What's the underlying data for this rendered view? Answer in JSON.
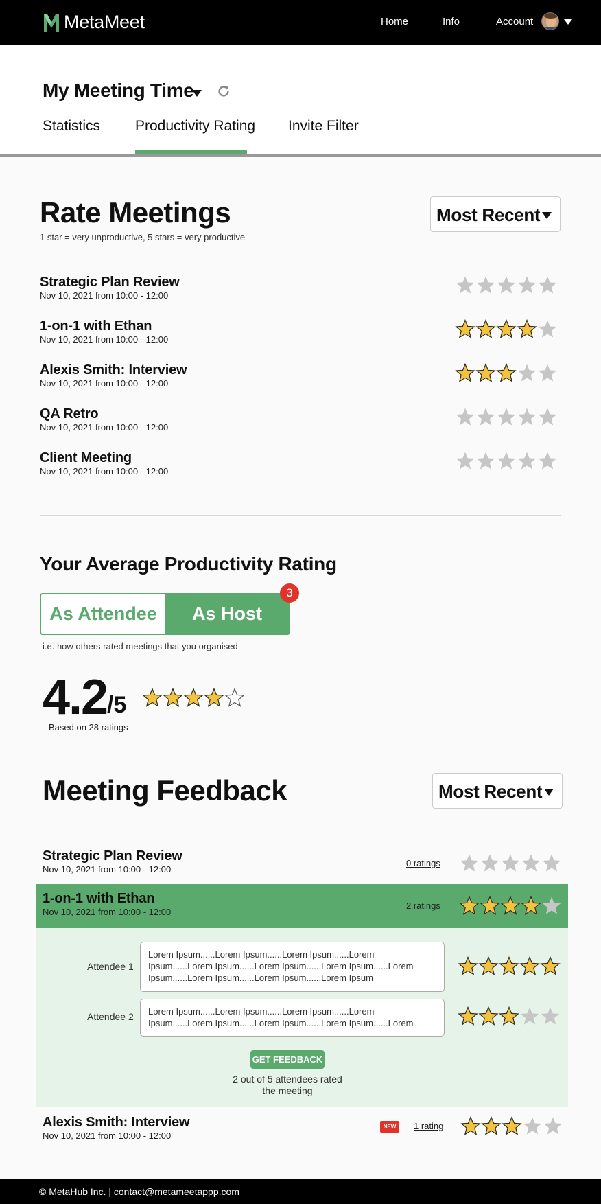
{
  "header": {
    "app_name": "MetaMeet",
    "nav": [
      "Home",
      "Info",
      "Account"
    ]
  },
  "subheader": {
    "title": "My Meeting Time",
    "tabs": [
      "Statistics",
      "Productivity Rating",
      "Invite Filter"
    ],
    "active_tab": "Productivity Rating"
  },
  "rate": {
    "title": "Rate Meetings",
    "hint": "1 star = very unproductive, 5 stars = very productive",
    "sort_label": "Most Recent",
    "meetings": [
      {
        "title": "Strategic Plan Review",
        "subtitle": "Nov 10, 2021 from 10:00 - 12:00",
        "stars": 0
      },
      {
        "title": "1-on-1 with Ethan",
        "subtitle": "Nov 10, 2021 from 10:00 - 12:00",
        "stars": 4
      },
      {
        "title": "Alexis Smith: Interview",
        "subtitle": "Nov 10, 2021 from 10:00 - 12:00",
        "stars": 3
      },
      {
        "title": "QA Retro",
        "subtitle": "Nov 10, 2021 from 10:00 - 12:00",
        "stars": 0
      },
      {
        "title": "Client Meeting",
        "subtitle": "Nov 10, 2021 from 10:00 - 12:00",
        "stars": 0
      }
    ]
  },
  "average": {
    "title": "Your Average Productivity Rating",
    "toggle_attendee": "As Attendee",
    "toggle_host": "As Host",
    "host_badge": "3",
    "hint": "i.e. how others rated meetings that you organised",
    "value": "4.2",
    "denominator": "/5",
    "stars": 4,
    "based_on": "Based on 28 ratings"
  },
  "feedback": {
    "title": "Meeting Feedback",
    "sort_label": "Most Recent",
    "items": [
      {
        "title": "Strategic Plan Review",
        "subtitle": "Nov 10, 2021 from 10:00 - 12:00",
        "ratings_label": "0 ratings",
        "stars": 0
      },
      {
        "title": "1-on-1 with Ethan",
        "subtitle": "Nov 10, 2021 from 10:00 - 12:00",
        "ratings_label": "2 ratings",
        "stars": 4
      },
      {
        "title": "Alexis Smith: Interview",
        "subtitle": "Nov 10, 2021 from 10:00 - 12:00",
        "ratings_label": "1 rating",
        "stars": 3,
        "badge": "NEW"
      }
    ],
    "expanded": {
      "attendees": [
        {
          "label": "Attendee 1",
          "comment": "Lorem Ipsum......Lorem Ipsum......Lorem Ipsum......Lorem Ipsum......Lorem Ipsum......Lorem Ipsum......Lorem Ipsum......Lorem Ipsum......Lorem Ipsum......Lorem Ipsum......Lorem Ipsum",
          "stars": 5
        },
        {
          "label": "Attendee 2",
          "comment": "Lorem Ipsum......Lorem Ipsum......Lorem Ipsum......Lorem Ipsum......Lorem Ipsum......Lorem Ipsum......Lorem Ipsum......Lorem",
          "stars": 3
        }
      ],
      "button_label": "GET FEEDBACK",
      "rated_note": "2 out of 5 attendees rated the meeting"
    }
  },
  "footer": {
    "text": "© MetaHub Inc. | contact@metameetappp.com"
  },
  "colors": {
    "accent_green": "#5aaa6e",
    "star_gold": "#f3c33d",
    "star_gray": "#c6c6c6",
    "badge_red": "#e0342b"
  }
}
